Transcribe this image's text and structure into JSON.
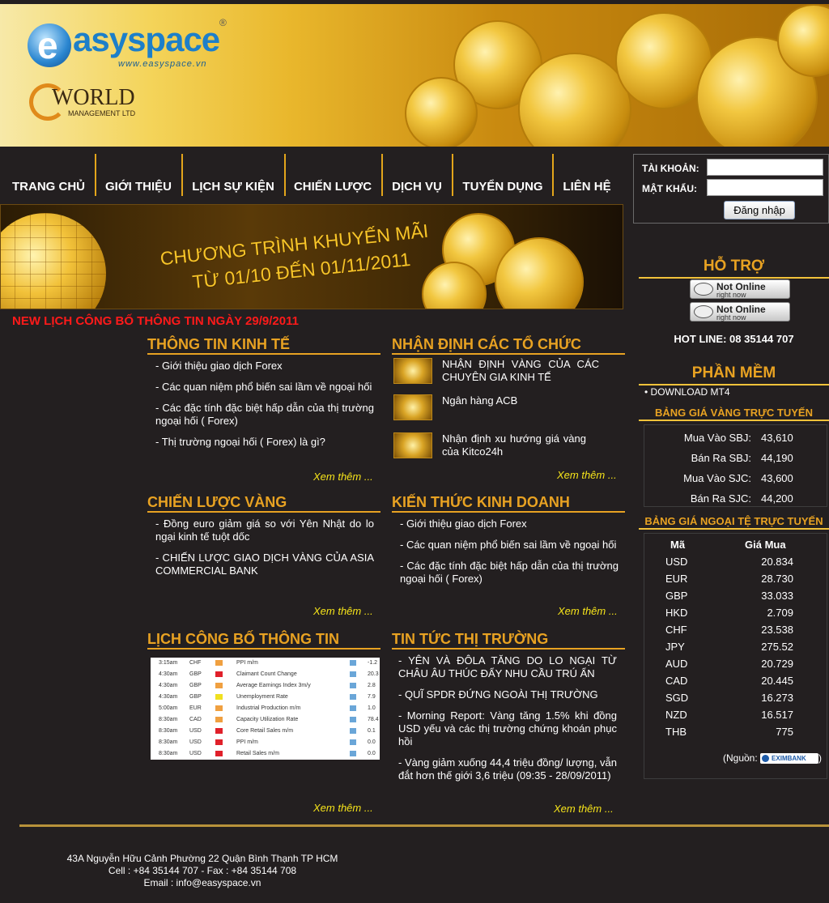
{
  "header": {
    "logo_text": "asyspace",
    "logo_letter": "e",
    "logo_url": "www.easyspace.vn",
    "logo_reg": "®",
    "partner_name": "WORLD",
    "partner_sub": "MANAGEMENT LTD"
  },
  "nav": {
    "items": [
      {
        "label": "TRANG CHỦ"
      },
      {
        "label": "GIỚI THIỆU"
      },
      {
        "label": "LỊCH SỰ KIỆN"
      },
      {
        "label": "CHIẾN LƯỢC"
      },
      {
        "label": "DỊCH VỤ"
      },
      {
        "label": "TUYỂN DỤNG"
      },
      {
        "label": "LIÊN HỆ"
      }
    ]
  },
  "login": {
    "account_label": "TÀI KHOẢN:",
    "password_label": "MẬT KHẨU:",
    "account_value": "",
    "password_value": "",
    "submit_label": "Đăng nhập"
  },
  "banner": {
    "line1": "CHƯƠNG TRÌNH KHUYẾN MÃI",
    "line2": "TỪ 01/10 ĐẾN 01/11/2011"
  },
  "announcement": "NEW LỊCH CÔNG BỐ THÔNG TIN NGÀY 29/9/2011",
  "sections": {
    "economic": {
      "title": "THÔNG TIN KINH TẾ",
      "items": [
        "- Giới thiệu giao dịch Forex",
        "- Các quan niệm phổ biến sai lầm về ngoại hối",
        "- Các đặc tính đặc biệt hấp dẫn của thị trường ngoại hối ( Forex)",
        "- Thị trường ngoại hối ( Forex) là gì?"
      ],
      "more": "Xem thêm ..."
    },
    "organizations": {
      "title": "NHẬN ĐỊNH CÁC TỔ CHỨC",
      "items": [
        "NHẬN ĐỊNH VÀNG CỦA CÁC CHUYÊN GIA KINH TẾ",
        "Ngân hàng ACB",
        "Nhận định xu hướng giá vàng của Kitco24h"
      ],
      "more": "Xem thêm ..."
    },
    "gold_strategy": {
      "title": "CHIẾN LƯỢC VÀNG",
      "items": [
        "- Đồng euro giảm giá so với Yên Nhật do lo ngại kinh tế tuột dốc",
        "- CHIẾN LƯỢC GIAO DỊCH VÀNG CỦA ASIA COMMERCIAL BANK"
      ],
      "more": "Xem thêm ..."
    },
    "business": {
      "title": "KIẾN THỨC KINH DOANH",
      "items": [
        "- Giới thiệu giao dịch Forex",
        "- Các quan niệm phổ biến sai lầm về ngoại hối",
        "- Các đặc tính đặc biệt hấp dẫn của thị trường ngoại hối ( Forex)"
      ],
      "more": "Xem thêm ..."
    },
    "calendar": {
      "title": "LỊCH CÔNG BỐ THÔNG TIN",
      "rows": [
        {
          "time": "3:15am",
          "cur": "CHF",
          "flag": "#f0a040",
          "event": "PPI m/m",
          "val": "-1.2"
        },
        {
          "time": "4:30am",
          "cur": "GBP",
          "flag": "#e0202a",
          "event": "Claimant Count Change",
          "val": "20.3"
        },
        {
          "time": "4:30am",
          "cur": "GBP",
          "flag": "#f0a040",
          "event": "Average Earnings Index 3m/y",
          "val": "2.8"
        },
        {
          "time": "4:30am",
          "cur": "GBP",
          "flag": "#f0e020",
          "event": "Unemployment Rate",
          "val": "7.9"
        },
        {
          "time": "5:00am",
          "cur": "EUR",
          "flag": "#f0a040",
          "event": "Industrial Production m/m",
          "val": "1.0"
        },
        {
          "time": "8:30am",
          "cur": "CAD",
          "flag": "#f0a040",
          "event": "Capacity Utilization Rate",
          "val": "78.4"
        },
        {
          "time": "8:30am",
          "cur": "USD",
          "flag": "#e0202a",
          "event": "Core Retail Sales m/m",
          "val": "0.1"
        },
        {
          "time": "8:30am",
          "cur": "USD",
          "flag": "#e0202a",
          "event": "PPI m/m",
          "val": "0.0"
        },
        {
          "time": "8:30am",
          "cur": "USD",
          "flag": "#e0202a",
          "event": "Retail Sales m/m",
          "val": "0.0"
        }
      ],
      "more": "Xem thêm ..."
    },
    "market_news": {
      "title": "TIN TỨC THỊ TRƯỜNG",
      "items": [
        "- YÊN VÀ ĐÔLA TĂNG DO LO NGẠI TỪ CHÂU ÂU THÚC ĐẨY NHU CẦU TRÚ ẨN",
        "- QUĨ SPDR ĐỨNG NGOÀI THỊ TRƯỜNG",
        "- Morning Report: Vàng tăng 1.5% khi đồng USD yếu và các thị trường chứng khoán phục hồi",
        "- Vàng giảm xuống 44,4 triệu đồng/ lượng, vẫn đắt hơn thế giới 3,6 triệu (09:35 - 28/09/2011)"
      ],
      "more": "Xem thêm ..."
    }
  },
  "sidebar": {
    "support_title": "HỖ TRỢ",
    "yahoo_status": "Not Online",
    "yahoo_sub": "right now",
    "hotline": "HOT LINE: 08 35144 707",
    "software_title": "PHẦN MỀM",
    "download": "• DOWNLOAD MT4",
    "gold_title": "BẢNG GIÁ VÀNG TRỰC TUYẾN",
    "gold_rows": [
      {
        "label": "Mua Vào SBJ:",
        "value": "43,610"
      },
      {
        "label": "Bán Ra SBJ:",
        "value": "44,190"
      },
      {
        "label": "Mua Vào SJC:",
        "value": "43,600"
      },
      {
        "label": "Bán Ra SJC:",
        "value": "44,200"
      }
    ],
    "fx_title": "BẢNG GIÁ NGOẠI TỆ TRỰC TUYẾN",
    "fx_head_code": "Mã",
    "fx_head_price": "Giá Mua",
    "fx_rows": [
      {
        "code": "USD",
        "value": "20.834"
      },
      {
        "code": "EUR",
        "value": "28.730"
      },
      {
        "code": "GBP",
        "value": "33.033"
      },
      {
        "code": "HKD",
        "value": "2.709"
      },
      {
        "code": "CHF",
        "value": "23.538"
      },
      {
        "code": "JPY",
        "value": "275.52"
      },
      {
        "code": "AUD",
        "value": "20.729"
      },
      {
        "code": "CAD",
        "value": "20.445"
      },
      {
        "code": "SGD",
        "value": "16.273"
      },
      {
        "code": "NZD",
        "value": "16.517"
      },
      {
        "code": "THB",
        "value": "775"
      }
    ],
    "source_prefix": "(Nguồn:",
    "source_bank": "EXIMBANK",
    "source_suffix": ")"
  },
  "footer": {
    "address": "43A Nguyễn Hữu Cảnh Phường 22 Quận Bình Thạnh TP HCM",
    "phone": "Cell : +84 35144 707 - Fax : +84 35144 708",
    "email": "Email : info@easyspace.vn"
  }
}
